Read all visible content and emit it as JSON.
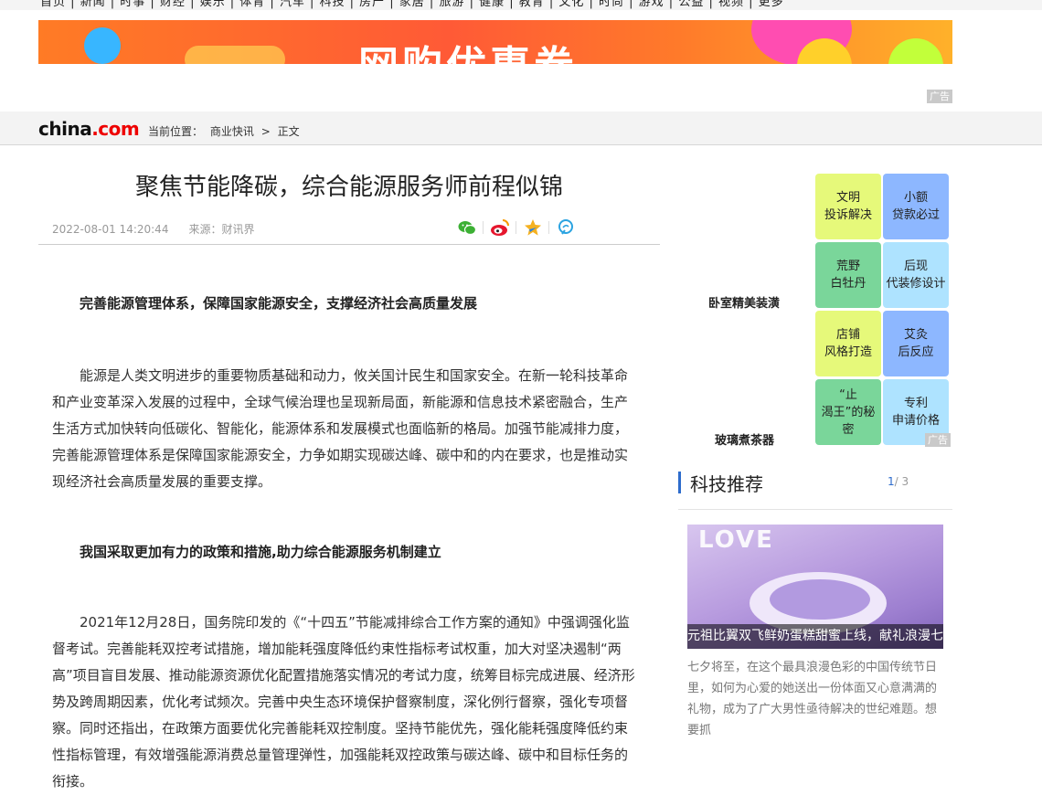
{
  "top_nav": {
    "text": "首页 | 新闻 | 时事 | 财经 | 娱乐 | 体育 | 汽车 | 科技 | 房产 | 家居 | 旅游 | 健康 | 教育 | 文化 | 时尚 | 游戏 | 公益 | 视频 | 更多"
  },
  "banner": {
    "text": "网购优惠券",
    "ad_label": "广告"
  },
  "header": {
    "logo_main": "china",
    "logo_com": ".com",
    "breadcrumb_prefix": "当前位置：",
    "breadcrumb_section": "商业快讯",
    "breadcrumb_sep": ">",
    "breadcrumb_current": "正文"
  },
  "article": {
    "title": "聚焦节能降碳，综合能源服务师前程似锦",
    "date": "2022-08-01 14:20:44",
    "source_label": "来源：",
    "source": "财讯界",
    "share_icons": [
      "wechat-icon",
      "weibo-icon",
      "qzone-icon",
      "qq-icon"
    ],
    "heading1": "完善能源管理体系，保障国家能源安全，支撑经济社会高质量发展",
    "para1": "能源是人类文明进步的重要物质基础和动力，攸关国计民生和国家安全。在新一轮科技革命和产业变革深入发展的过程中，全球气候治理也呈现新局面，新能源和信息技术紧密融合，生产生活方式加快转向低碳化、智能化，能源体系和发展模式也面临新的格局。加强节能减排力度，完善能源管理体系是保障国家能源安全，力争如期实现碳达峰、碳中和的内在要求，也是推动实现经济社会高质量发展的重要支撑。",
    "heading2": "我国采取更加有力的政策和措施,助力综合能源服务机制建立",
    "para2": "2021年12月28日，国务院印发的《“十四五”节能减排综合工作方案的通知》中强调强化监督考试。完善能耗双控考试措施，增加能耗强度降低约束性指标考试权重，加大对坚决遏制“两高”项目盲目发展、推动能源资源优化配置措施落实情况的考试力度，统筹目标完成进展、经济形势及跨周期因素，优化考试频次。完善中央生态环境保护督察制度，深化例行督察，强化专项督察。同时还指出，在政策方面要优化完善能耗双控制度。坚持节能优先，强化能耗强度降低约束性指标管理，有效增强能源消费总量管理弹性，加强能耗双控政策与碳达峰、碳中和目标任务的衔接。"
  },
  "sidebar": {
    "label1": "卧室精美装潢",
    "label2": "玻璃煮茶器",
    "ad_label": "广告",
    "tiles": [
      "文明\n投诉解决",
      "小额\n贷款必过",
      "荒野\n白牡丹",
      "后现\n代装修设计",
      "店铺\n风格打造",
      "艾灸\n后反应",
      "“止\n渴王”的秘\n密",
      "专利\n申请价格"
    ],
    "tech_title": "科技推荐",
    "tech_page_current": "1",
    "tech_page_total": "/ 3",
    "feature_image_text": "LOVE",
    "feature_caption": "元祖比翼双飞鲜奶蛋糕甜蜜上线，献礼浪漫七夕",
    "feature_summary": "七夕将至，在这个最具浪漫色彩的中国传统节日里，如何为心爱的她送出一份体面又心意满满的礼物，成为了广大男性亟待解决的世纪难题。想要抓"
  },
  "colors": {
    "accent": "#2d6ccc",
    "logo_red": "#ee0000"
  }
}
